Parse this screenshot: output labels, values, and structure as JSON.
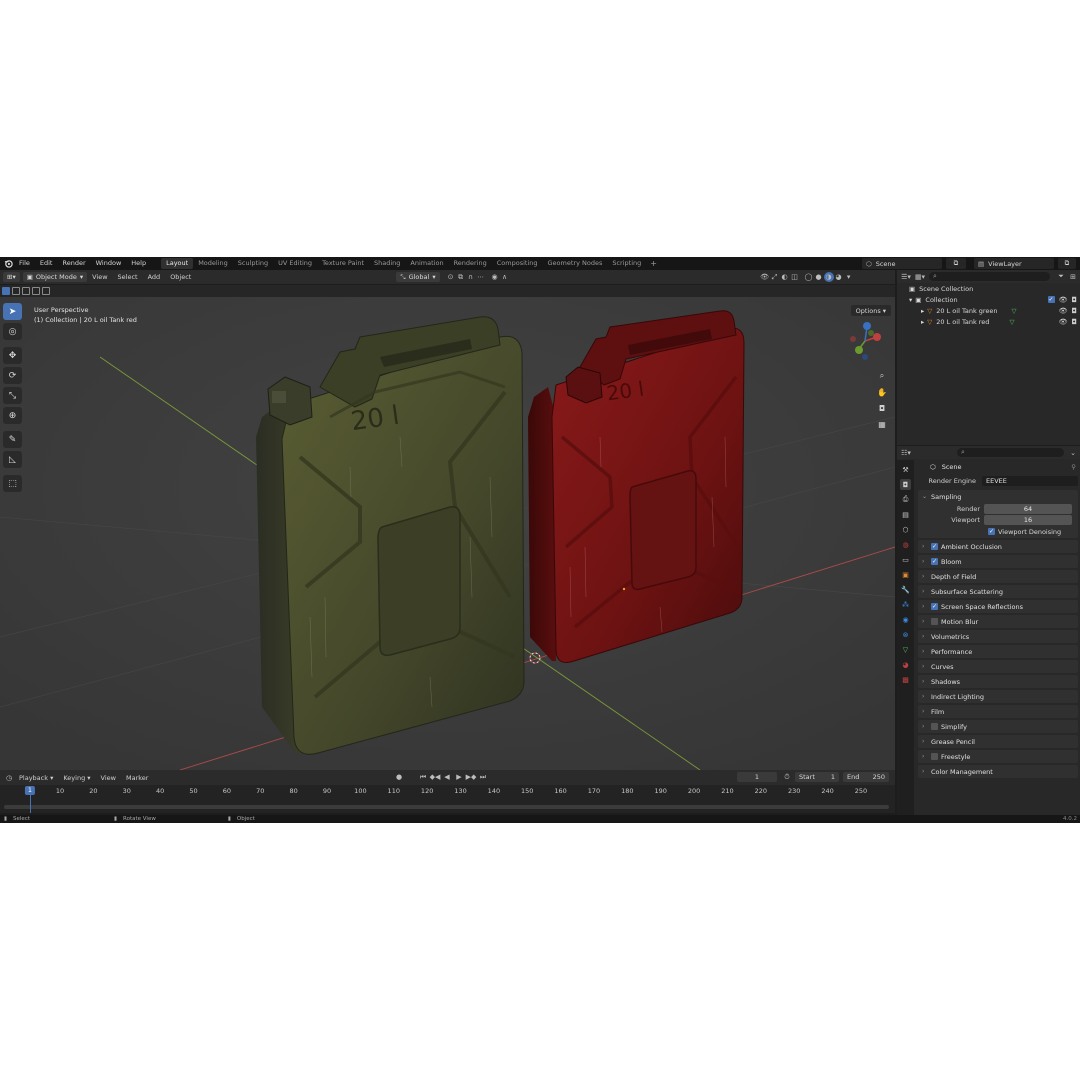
{
  "colors": {
    "accent": "#4772b3",
    "viewport_bg": "#3d3d3d",
    "axis_x": "#b04a4a",
    "axis_y": "#7a9a3a",
    "green_can": "#4a4f2a",
    "red_can": "#7a1515"
  },
  "menu": [
    "File",
    "Edit",
    "Render",
    "Window",
    "Help"
  ],
  "workspaces": [
    "Layout",
    "Modeling",
    "Sculpting",
    "UV Editing",
    "Texture Paint",
    "Shading",
    "Animation",
    "Rendering",
    "Compositing",
    "Geometry Nodes",
    "Scripting"
  ],
  "active_workspace": "Layout",
  "scene_name": "Scene",
  "view_layer": "ViewLayer",
  "viewport_header": {
    "mode": "Object Mode",
    "menus": [
      "View",
      "Select",
      "Add",
      "Object"
    ],
    "transform_orientation": "Global",
    "options": "Options"
  },
  "viewport_info": {
    "perspective": "User Perspective",
    "collection": "(1) Collection | 20 L oil Tank red"
  },
  "model_labels": {
    "green_text": "20 l",
    "red_text": "20 l"
  },
  "outliner": {
    "root": "Scene Collection",
    "collection": "Collection",
    "objects": [
      "20 L oil Tank green",
      "20 L oil Tank red"
    ]
  },
  "properties": {
    "scene_title": "Scene",
    "render_engine_label": "Render Engine",
    "render_engine": "EEVEE",
    "sampling": {
      "title": "Sampling",
      "render_label": "Render",
      "render": "64",
      "viewport_label": "Viewport",
      "viewport": "16",
      "denoise": "Viewport Denoising"
    },
    "panels": [
      {
        "label": "Ambient Occlusion",
        "checkbox": true,
        "checked": true
      },
      {
        "label": "Bloom",
        "checkbox": true,
        "checked": true
      },
      {
        "label": "Depth of Field",
        "checkbox": false,
        "checked": false
      },
      {
        "label": "Subsurface Scattering",
        "checkbox": false,
        "checked": false
      },
      {
        "label": "Screen Space Reflections",
        "checkbox": true,
        "checked": true
      },
      {
        "label": "Motion Blur",
        "checkbox": true,
        "checked": false
      },
      {
        "label": "Volumetrics",
        "checkbox": false,
        "checked": false
      },
      {
        "label": "Performance",
        "checkbox": false,
        "checked": false
      },
      {
        "label": "Curves",
        "checkbox": false,
        "checked": false
      },
      {
        "label": "Shadows",
        "checkbox": false,
        "checked": false
      },
      {
        "label": "Indirect Lighting",
        "checkbox": false,
        "checked": false
      },
      {
        "label": "Film",
        "checkbox": false,
        "checked": false
      },
      {
        "label": "Simplify",
        "checkbox": true,
        "checked": false
      },
      {
        "label": "Grease Pencil",
        "checkbox": false,
        "checked": false
      },
      {
        "label": "Freestyle",
        "checkbox": true,
        "checked": false
      },
      {
        "label": "Color Management",
        "checkbox": false,
        "checked": false
      }
    ]
  },
  "timeline": {
    "menus": [
      "Playback",
      "Keying",
      "View",
      "Marker"
    ],
    "current_frame": "1",
    "start_label": "Start",
    "start": "1",
    "end_label": "End",
    "end": "250",
    "ticks": [
      "1",
      "10",
      "20",
      "30",
      "40",
      "50",
      "60",
      "70",
      "80",
      "90",
      "100",
      "110",
      "120",
      "130",
      "140",
      "150",
      "160",
      "170",
      "180",
      "190",
      "200",
      "210",
      "220",
      "230",
      "240",
      "250"
    ]
  },
  "statusbar": {
    "select": "Select",
    "rotate": "Rotate View",
    "object": "Object",
    "version": "4.0.2"
  }
}
